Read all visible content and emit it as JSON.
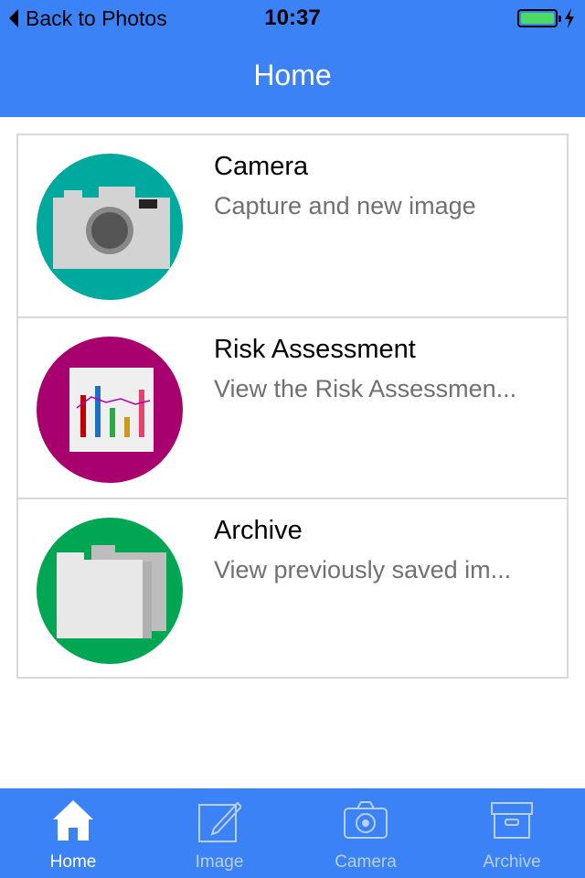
{
  "status_bar": {
    "back_label": "Back to Photos",
    "time": "10:37",
    "battery_level": 1.0
  },
  "header": {
    "title": "Home"
  },
  "list": {
    "items": [
      {
        "title": "Camera",
        "subtitle": "Capture and new image",
        "icon": "camera-icon",
        "color": "#00a99d"
      },
      {
        "title": "Risk Assessment",
        "subtitle": "View the Risk Assessmen...",
        "icon": "chart-icon",
        "color": "#a8006f"
      },
      {
        "title": "Archive",
        "subtitle": "View previously saved im...",
        "icon": "folder-icon",
        "color": "#00a651"
      }
    ]
  },
  "tabs": [
    {
      "label": "Home",
      "icon": "home-icon",
      "active": true
    },
    {
      "label": "Image",
      "icon": "edit-image-icon",
      "active": false
    },
    {
      "label": "Camera",
      "icon": "camera-icon",
      "active": false
    },
    {
      "label": "Archive",
      "icon": "archive-box-icon",
      "active": false
    }
  ],
  "colors": {
    "primary": "#3b82f6",
    "tab_inactive": "#b7d0f7",
    "battery": "#4cd964"
  }
}
